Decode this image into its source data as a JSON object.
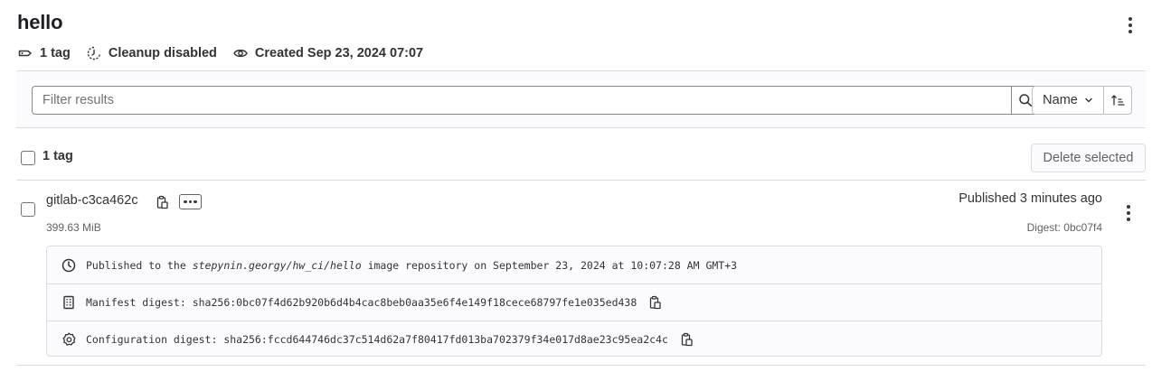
{
  "repo": {
    "title": "hello",
    "tag_count": "1 tag",
    "cleanup": "Cleanup disabled",
    "created": "Created Sep 23, 2024 07:07"
  },
  "filter": {
    "placeholder": "Filter results",
    "sort_label": "Name"
  },
  "list": {
    "count_label": "1 tag",
    "delete_label": "Delete selected"
  },
  "tag": {
    "name": "gitlab-c3ca462c",
    "size": "399.63 MiB",
    "published": "Published 3 minutes ago",
    "digest_short": "Digest: 0bc07f4",
    "details": {
      "published_prefix": "Published to the ",
      "published_path": "stepynin.georgy/hw_ci/hello",
      "published_suffix": " image repository on September 23, 2024 at 10:07:28 AM GMT+3",
      "manifest": "Manifest digest: sha256:0bc07f4d62b920b6d4b4cac8beb0aa35e6f4e149f18cece68797fe1e035ed438",
      "configuration": "Configuration digest: sha256:fccd644746dc37c514d62a7f80417fd013ba702379f34e017d8ae23c95ea2c4c"
    }
  },
  "icons": {
    "tag": "label-icon",
    "cleanup": "clock-alert-icon",
    "created": "eye-icon",
    "search": "search-icon",
    "sort": "sort-ascending-icon",
    "copy": "copy-to-clipboard-icon",
    "more": "ellipsis-icon",
    "clock": "clock-icon",
    "manifest": "document-icon",
    "config": "settings-icon",
    "kebab": "kebab-menu-icon"
  }
}
